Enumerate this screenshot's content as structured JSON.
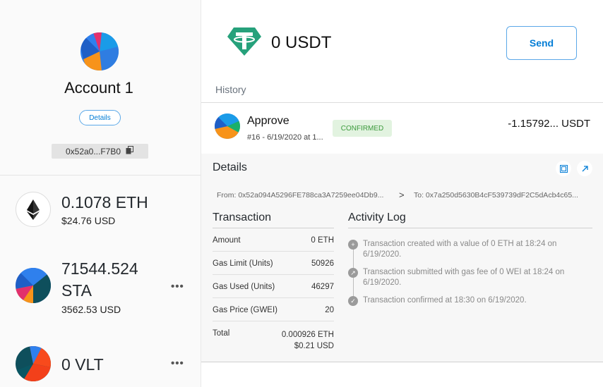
{
  "sidebar": {
    "account_name": "Account 1",
    "details_label": "Details",
    "address": "0x52a0...F7B0",
    "tokens": [
      {
        "amount": "0.1078 ETH",
        "fiat": "$24.76 USD",
        "icon": "ethereum-icon"
      },
      {
        "amount_line1": "71544.524",
        "amount_line2": "STA",
        "fiat": "3562.53 USD",
        "icon": "identicon",
        "menu": "•••"
      },
      {
        "amount": "0 VLT",
        "icon": "identicon",
        "menu": "•••"
      }
    ]
  },
  "asset": {
    "balance": "0 USDT",
    "icon": "tether-icon",
    "send_label": "Send",
    "history_label": "History"
  },
  "transaction": {
    "title": "Approve",
    "subtitle": "#16 - 6/19/2020 at 1...",
    "status": "CONFIRMED",
    "value": "-1.15792...  USDT"
  },
  "details": {
    "title": "Details",
    "from": "From: 0x52a094A5296FE788ca3A7259ee04Db9...",
    "arrow": ">",
    "to": "To: 0x7a250d5630B4cF539739dF2C5dAcb4c65...",
    "tx_section_title": "Transaction",
    "rows": [
      {
        "label": "Amount",
        "value": "0 ETH"
      },
      {
        "label": "Gas Limit (Units)",
        "value": "50926"
      },
      {
        "label": "Gas Used (Units)",
        "value": "46297"
      },
      {
        "label": "Gas Price (GWEI)",
        "value": "20"
      }
    ],
    "total_label": "Total",
    "total_eth": "0.000926 ETH",
    "total_usd": "$0.21 USD",
    "log_title": "Activity Log",
    "log": [
      {
        "text": "Transaction created with a value of 0 ETH at 18:24 on 6/19/2020.",
        "icon": "plus-icon"
      },
      {
        "text": "Transaction submitted with gas fee of 0 WEI at 18:24 on 6/19/2020.",
        "icon": "arrow-up-right-icon"
      },
      {
        "text": "Transaction confirmed at 18:30 on 6/19/2020.",
        "icon": "check-icon"
      }
    ]
  },
  "colors": {
    "accent": "#037dd6",
    "confirmed_bg": "#e2f3e0",
    "confirmed_text": "#3c9a3c",
    "tether": "#26a17b"
  }
}
